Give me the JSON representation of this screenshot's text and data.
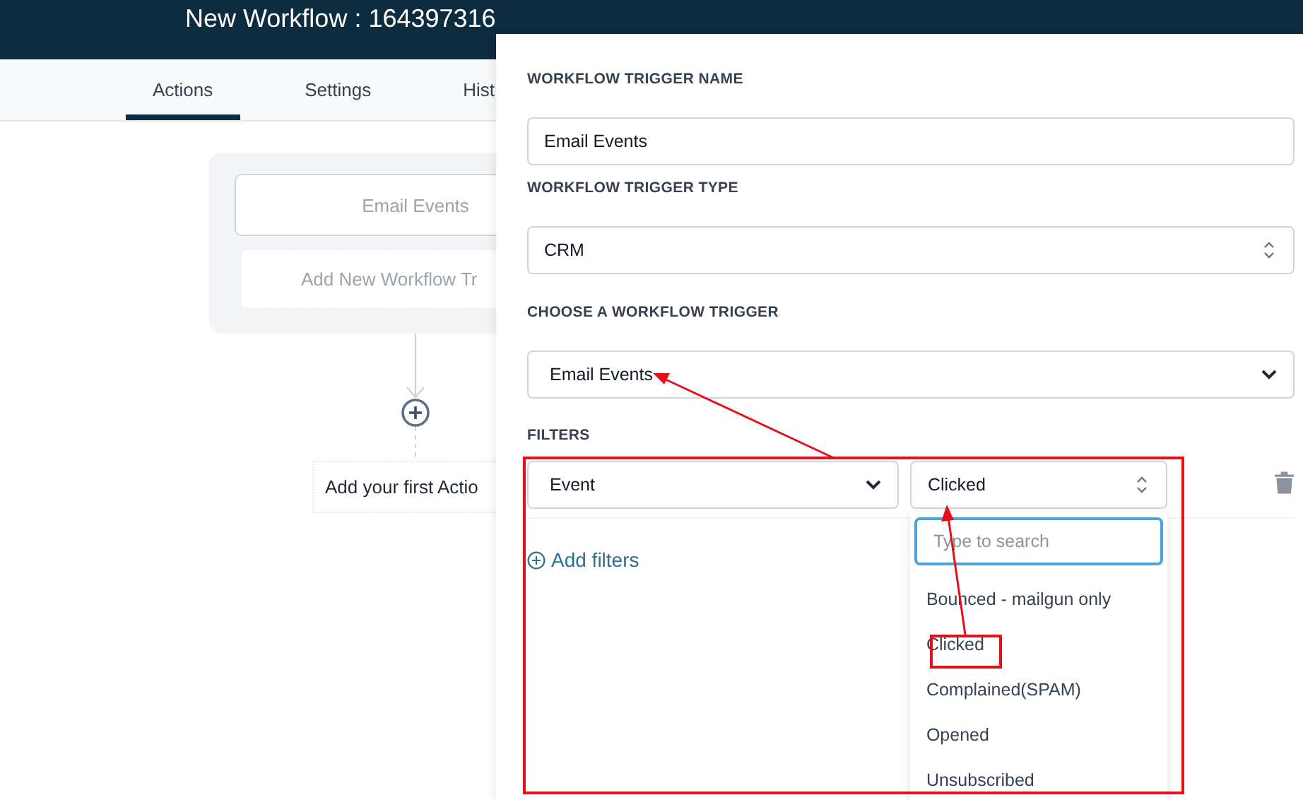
{
  "header": {
    "title": "New Workflow : 164397316"
  },
  "tabs": [
    {
      "label": "Actions",
      "selected": true
    },
    {
      "label": "Settings",
      "selected": false
    },
    {
      "label": "Hist",
      "selected": false
    }
  ],
  "trigger_card": {
    "trigger": "Email Events",
    "add_trigger": "Add New Workflow Tr"
  },
  "add_action": "Add your first Actio",
  "drawer": {
    "trigger_name": {
      "label": "WORKFLOW TRIGGER NAME",
      "value": "Email Events"
    },
    "trigger_type": {
      "label": "WORKFLOW TRIGGER TYPE",
      "value": "CRM"
    },
    "trigger": {
      "label": "CHOOSE A WORKFLOW TRIGGER",
      "value": "Email Events"
    },
    "filters": {
      "label": "FILTERS",
      "rows": [
        {
          "field": "Event",
          "value": "Clicked",
          "dropdown": {
            "placeholder": "Type to search",
            "options": [
              "Bounced - mailgun only",
              "Clicked",
              "Complained(SPAM)",
              "Opened",
              "Unsubscribed"
            ]
          }
        }
      ],
      "add_label": "Add filters"
    }
  }
}
